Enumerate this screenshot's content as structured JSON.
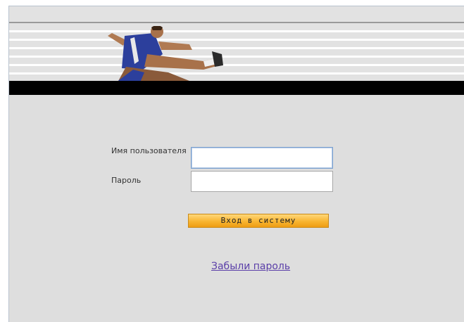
{
  "login": {
    "username_label": "Имя пользователя",
    "username_value": "",
    "password_label": "Пароль",
    "password_value": "",
    "submit_label": "Вход в систему",
    "forgot_link": "Забыли пароль"
  },
  "colors": {
    "background": "#dedede",
    "button": "#f8b531",
    "link": "#5a3ea8",
    "banner_bar": "#000000"
  },
  "banner": {
    "image": "hurdler-athlete-photo"
  }
}
